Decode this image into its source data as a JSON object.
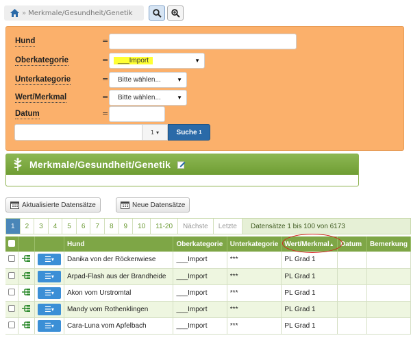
{
  "breadcrumb": {
    "separator": "»",
    "path": "Merkmale/Gesundheit/Genetik"
  },
  "filter": {
    "rows": [
      {
        "label": "Hund",
        "eq": "=",
        "value": ""
      },
      {
        "label": "Oberkategorie",
        "eq": "=",
        "value": "___Import"
      },
      {
        "label": "Unterkategorie",
        "eq": "=",
        "value": "Bitte wählen..."
      },
      {
        "label": "Wert/Merkmal",
        "eq": "=",
        "value": "Bitte wählen..."
      },
      {
        "label": "Datum",
        "eq": "=",
        "value": ""
      }
    ],
    "search_count": "1",
    "search_button": "Suche",
    "search_badge": "1"
  },
  "section": {
    "title": "Merkmale/Gesundheit/Genetik"
  },
  "actions": {
    "updated": "Aktualisierte Datensätze",
    "new": "Neue Datensätze"
  },
  "pager": {
    "pages": [
      "1",
      "2",
      "3",
      "4",
      "5",
      "6",
      "7",
      "8",
      "9",
      "10",
      "11-20",
      "Nächste",
      "Letzte"
    ],
    "info": "Datensätze 1 bis 100 von 6173"
  },
  "table": {
    "columns": [
      "Hund",
      "Oberkategorie",
      "Unterkategorie",
      "Wert/Merkmal",
      "Datum",
      "Bemerkung"
    ],
    "rows": [
      {
        "hund": "Danika von der Röckenwiese",
        "ober": "___Import",
        "unter": "***",
        "wert": "PL Grad 1",
        "datum": "",
        "bem": ""
      },
      {
        "hund": "Arpad-Flash aus der Brandheide",
        "ober": "___Import",
        "unter": "***",
        "wert": "PL Grad 1",
        "datum": "",
        "bem": ""
      },
      {
        "hund": "Akon vom Urstromtal",
        "ober": "___Import",
        "unter": "***",
        "wert": "PL Grad 1",
        "datum": "",
        "bem": ""
      },
      {
        "hund": "Mandy vom Rothenklingen",
        "ober": "___Import",
        "unter": "***",
        "wert": "PL Grad 1",
        "datum": "",
        "bem": ""
      },
      {
        "hund": "Cara-Luna vom Apfelbach",
        "ober": "___Import",
        "unter": "***",
        "wert": "PL Grad 1",
        "datum": "",
        "bem": ""
      }
    ]
  },
  "colors": {
    "accent": "#7ea646",
    "filter_bg": "#fbb06b",
    "highlight": "#ffff33",
    "primary": "#2a6aa8",
    "annotation": "#d61e1e"
  },
  "icons": [
    "home-icon",
    "search-icon",
    "zoom-icon",
    "edit-icon",
    "caduceus-icon",
    "calendar-icon",
    "tree-icon",
    "menu-icon",
    "sort-asc-icon"
  ]
}
